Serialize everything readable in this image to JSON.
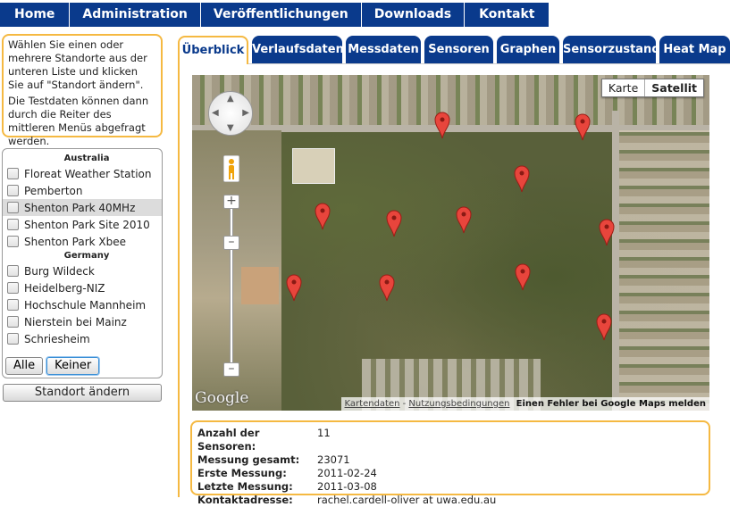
{
  "nav": {
    "items": [
      "Home",
      "Administration",
      "Veröffentlichungen",
      "Downloads",
      "Kontakt"
    ]
  },
  "info": {
    "line1": "Wählen Sie einen oder mehrere Standorte aus der unteren Liste und klicken Sie auf \"Standort ändern\".",
    "line2": "Die Testdaten können dann durch die Reiter des mittleren Menüs abgefragt werden."
  },
  "locations": {
    "group1": "Australia",
    "g1_items": [
      "Floreat Weather Station",
      "Pemberton",
      "Shenton Park 40MHz",
      "Shenton Park Site 2010",
      "Shenton Park Xbee"
    ],
    "group2": "Germany",
    "g2_items": [
      "Burg Wildeck",
      "Heidelberg-NIZ",
      "Hochschule Mannheim",
      "Nierstein bei Mainz",
      "Schriesheim"
    ],
    "selected": "Shenton Park 40MHz"
  },
  "buttons": {
    "all": "Alle",
    "none": "Keiner",
    "change_location": "Standort ändern"
  },
  "tabs": [
    "Überblick",
    "Verlaufsdaten",
    "Messdaten",
    "Sensoren",
    "Graphen",
    "Sensorzustand",
    "Heat Map"
  ],
  "active_tab": "Überblick",
  "map": {
    "type_map": "Karte",
    "type_satellite": "Satellit",
    "active_type": "Satellit",
    "logo": "Google",
    "footer_data": "Kartendaten",
    "footer_sep": " - ",
    "footer_terms": "Nutzungsbedingungen",
    "footer_error": "Einen Fehler bei Google Maps melden",
    "marker_count": 11
  },
  "details": {
    "rows": [
      {
        "label": "Anzahl der Sensoren:",
        "value": "11"
      },
      {
        "label": "Messung gesamt:",
        "value": "23071"
      },
      {
        "label": "Erste Messung:",
        "value": "2011-02-24"
      },
      {
        "label": "Letzte Messung:",
        "value": "2011-03-08"
      },
      {
        "label": "Kontaktadresse:",
        "value": "rachel.cardell-oliver at uwa.edu.au"
      }
    ]
  },
  "colors": {
    "nav_blue": "#0a3a8c",
    "accent_orange": "#f5b942",
    "marker_red": "#e8453c"
  }
}
